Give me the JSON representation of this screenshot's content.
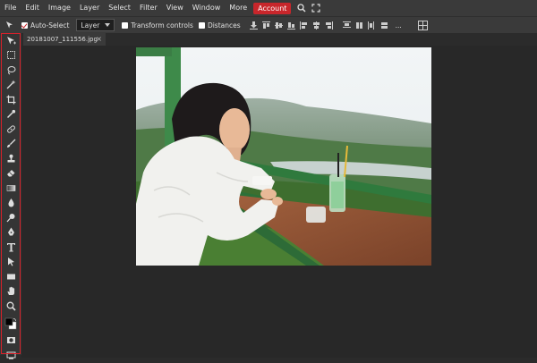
{
  "menu": [
    "File",
    "Edit",
    "Image",
    "Layer",
    "Select",
    "Filter",
    "View",
    "Window",
    "More",
    "Account"
  ],
  "options": {
    "auto_select_label": "Auto-Select",
    "layer_select": "Layer",
    "transform_label": "Transform controls",
    "distances_label": "Distances",
    "more": "..."
  },
  "document": {
    "tab_title": "20181007_111556.jpg",
    "close": "×"
  },
  "colors": {
    "accent": "#c8262b",
    "outline": "#d8202a"
  },
  "tools": [
    "move-tool-icon",
    "marquee-tool-icon",
    "lasso-tool-icon",
    "magic-wand-icon",
    "crop-tool-icon",
    "eyedropper-icon",
    "healing-brush-icon",
    "brush-tool-icon",
    "clone-stamp-icon",
    "eraser-icon",
    "gradient-tool-icon",
    "blur-tool-icon",
    "dodge-tool-icon",
    "pen-tool-icon",
    "type-tool-icon",
    "path-select-icon",
    "shape-tool-icon",
    "hand-tool-icon",
    "zoom-tool-icon",
    "color-swatches-icon",
    "quick-mask-icon",
    "screen-mode-icon"
  ]
}
